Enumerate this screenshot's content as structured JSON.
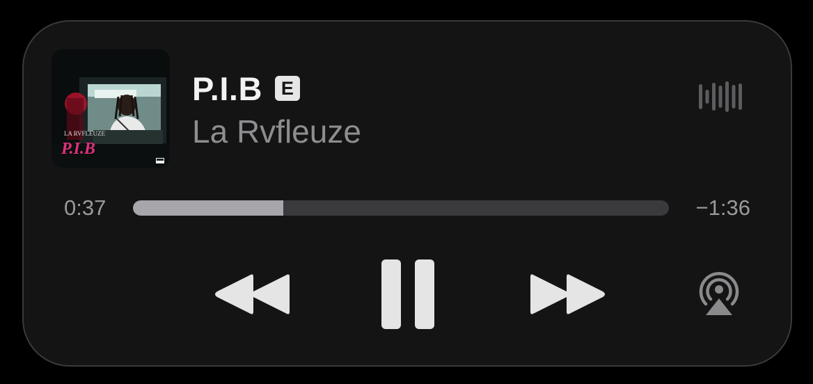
{
  "track": {
    "title": "P.I.B",
    "explicit_badge": "E",
    "artist": "La Rvfleuze"
  },
  "album_art": {
    "artist_text": "LA RVFLEUZE",
    "title_text": "P.I.B",
    "accent": "#e0307a"
  },
  "playback": {
    "elapsed": "0:37",
    "remaining": "−1:36",
    "progress_fraction": 0.28,
    "state": "playing"
  },
  "controls": {
    "rewind_icon": "rewind-icon",
    "pause_icon": "pause-icon",
    "forward_icon": "fast-forward-icon",
    "airplay_icon": "airplay-icon",
    "waveform_icon": "waveform-icon"
  },
  "colors": {
    "background": "#141415",
    "title": "#f2f2f2",
    "subtitle": "#8e8e90",
    "progress_fill": "#a6a6ab",
    "progress_track": "#3a3a3c",
    "control": "#e5e5e5"
  }
}
